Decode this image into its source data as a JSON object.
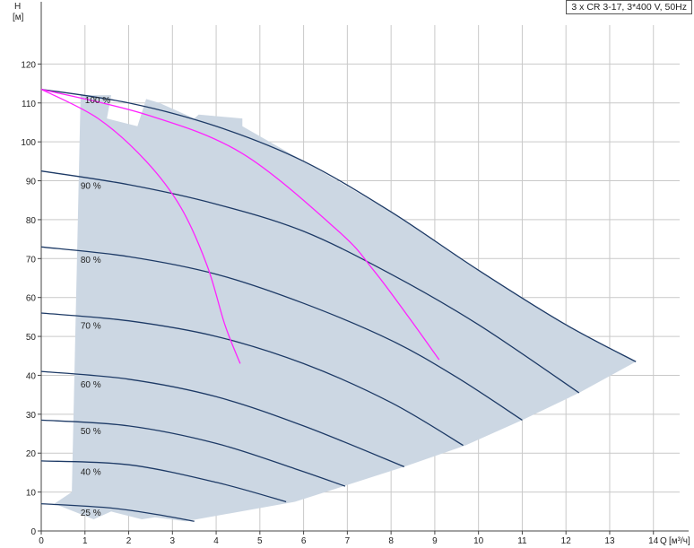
{
  "chart_data": {
    "type": "line",
    "title": "3 x CR 3-17, 3*400 V, 50Hz",
    "ylabel": "H",
    "yunit": "[м]",
    "xlabel": "Q",
    "xunit": "[м³/ч]",
    "xlim": [
      0,
      14.6
    ],
    "ylim": [
      0,
      130
    ],
    "xticks": [
      0,
      1,
      2,
      3,
      4,
      5,
      6,
      7,
      8,
      9,
      10,
      11,
      12,
      13,
      14
    ],
    "yticks": [
      0,
      10,
      20,
      30,
      40,
      50,
      60,
      70,
      80,
      90,
      100,
      110,
      120
    ],
    "grid": true,
    "colors": {
      "curve": "#1d3a66",
      "system": "#ff22ff",
      "region": "#ccd7e3",
      "grid": "#c9c9c9",
      "axis": "#444444"
    },
    "series": [
      {
        "name": "100 %",
        "x": [
          0,
          2,
          4,
          6,
          8,
          10,
          12,
          13.6
        ],
        "y": [
          113.5,
          110,
          104,
          95,
          82,
          67,
          53,
          43.5
        ]
      },
      {
        "name": "90 %",
        "x": [
          0,
          2,
          4,
          6,
          8,
          10,
          12.3
        ],
        "y": [
          92.5,
          89,
          84,
          77,
          66,
          53,
          35.5
        ]
      },
      {
        "name": "80 %",
        "x": [
          0,
          2,
          4,
          6,
          8,
          9.5,
          11
        ],
        "y": [
          73,
          70.5,
          66,
          58.5,
          49,
          39.5,
          28.5
        ]
      },
      {
        "name": "70 %",
        "x": [
          0,
          2,
          4,
          6,
          8,
          9.65
        ],
        "y": [
          56,
          54,
          50,
          43,
          33,
          22
        ]
      },
      {
        "name": "60 %",
        "x": [
          0,
          2,
          4,
          6,
          8.3
        ],
        "y": [
          41,
          39,
          34.5,
          27,
          16.5
        ]
      },
      {
        "name": "50 %",
        "x": [
          0,
          2,
          4,
          5.8,
          6.95
        ],
        "y": [
          28.5,
          27,
          22.5,
          16,
          11.5
        ]
      },
      {
        "name": "40 %",
        "x": [
          0,
          2,
          4,
          5.6
        ],
        "y": [
          18,
          17,
          12.5,
          7.5
        ]
      },
      {
        "name": "25 %",
        "x": [
          0,
          1.5,
          2.5,
          3.5
        ],
        "y": [
          7,
          6,
          4.5,
          2.5
        ]
      }
    ],
    "system_curves": [
      {
        "x": [
          0,
          1.3,
          2.4,
          3.2,
          3.8,
          4.2,
          4.55
        ],
        "y": [
          113.5,
          106,
          95,
          83,
          68,
          53,
          43
        ]
      },
      {
        "x": [
          0,
          2.4,
          4.6,
          6.8,
          7.6,
          8.4,
          9.1
        ],
        "y": [
          113.5,
          107,
          97,
          77,
          67,
          55,
          44
        ]
      }
    ],
    "region": {
      "x": [
        0.3,
        1.2,
        1.6,
        2.3,
        2.6,
        3.3,
        5.8,
        8.3,
        9.7,
        11,
        12.3,
        13.6,
        13.6,
        12,
        10,
        8,
        6,
        4.6,
        4.6,
        3.6,
        3.5,
        2.7,
        2.4,
        2.2,
        1.5,
        1.6,
        0.9,
        0.7
      ],
      "y": [
        7,
        3,
        5,
        3,
        3.5,
        2.5,
        7.5,
        16.5,
        22,
        28.5,
        35.5,
        43.5,
        43.5,
        53,
        67,
        82,
        95,
        104,
        106,
        107,
        106,
        110,
        111,
        104,
        106,
        112,
        112,
        10
      ]
    },
    "labels": {
      "100 %": [
        1.0,
        109
      ],
      "90 %": [
        0.9,
        87
      ],
      "80 %": [
        0.9,
        68
      ],
      "70 %": [
        0.9,
        51
      ],
      "60 %": [
        0.9,
        36
      ],
      "50 %": [
        0.9,
        24
      ],
      "40 %": [
        0.9,
        13.5
      ],
      "25 %": [
        0.9,
        3
      ]
    }
  }
}
